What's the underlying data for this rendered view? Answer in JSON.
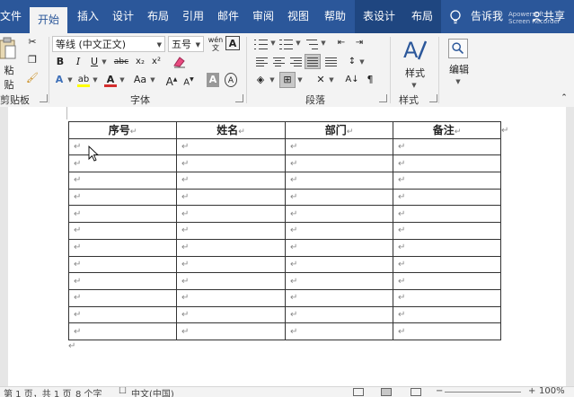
{
  "tabs": [
    {
      "label": "文件"
    },
    {
      "label": "开始"
    },
    {
      "label": "插入"
    },
    {
      "label": "设计"
    },
    {
      "label": "布局"
    },
    {
      "label": "引用"
    },
    {
      "label": "邮件"
    },
    {
      "label": "审阅"
    },
    {
      "label": "视图"
    },
    {
      "label": "帮助"
    },
    {
      "label": "表设计"
    },
    {
      "label": "布局"
    }
  ],
  "tell_me": "告诉我",
  "share": "共享",
  "watermark": [
    "Apowersoft",
    "Screen Recorder"
  ],
  "clipboard": {
    "paste_label": "粘贴",
    "group_label": "剪贴板"
  },
  "font": {
    "family": "等线 (中文正文)",
    "size": "五号",
    "wen_icon": "wén",
    "group_label": "字体",
    "bold": "B",
    "italic": "I",
    "underline": "U",
    "strike": "abc",
    "subscript": "x₂",
    "superscript": "x²",
    "case": "Aa",
    "grow": "A",
    "shrink": "A",
    "shade": "A",
    "border": "A",
    "highlight_color": "#ffff00",
    "font_color": "#d42e2e"
  },
  "paragraph": {
    "group_label": "段落"
  },
  "styles": {
    "button_label": "样式",
    "group_label": "样式"
  },
  "editing": {
    "button_label": "编辑"
  },
  "table": {
    "headers": [
      "序号",
      "姓名",
      "部门",
      "备注"
    ],
    "row_count": 12,
    "cell_mark": "↵"
  },
  "status": {
    "page": "第 1 页，共 1 页",
    "words": "8 个字",
    "language": "中文(中国)",
    "zoom": "100%"
  }
}
